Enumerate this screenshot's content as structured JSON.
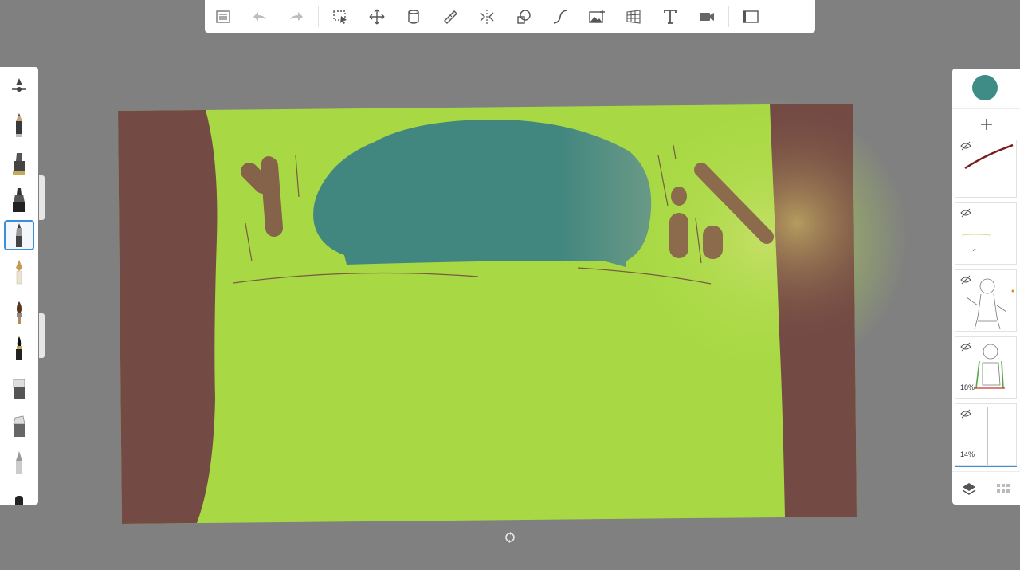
{
  "toolbar": {
    "icons": [
      "list-icon",
      "undo-icon",
      "redo-icon",
      "selection-icon",
      "transform-icon",
      "fill-icon",
      "ruler-icon",
      "symmetry-icon",
      "shapes-icon",
      "curve-icon",
      "image-icon",
      "perspective-icon",
      "text-icon",
      "record-icon",
      "fullscreen-icon"
    ]
  },
  "brushes": {
    "icons": [
      "brush-size-icon",
      "pencil-icon",
      "airbrush-icon",
      "marker-icon",
      "ballpoint-icon",
      "fountain-pen-icon",
      "paintbrush-icon",
      "ink-brush-icon",
      "eraser-icon",
      "hard-eraser-icon",
      "smudge-icon",
      "chisel-icon"
    ],
    "selected_index": 3
  },
  "colors": {
    "current": "#3f8c86",
    "background": "#808080",
    "canvas_green": "#a8d944",
    "tree_brown": "#744b44",
    "foliage_teal": "#428680",
    "selection_blue": "#3b8fd6"
  },
  "layers": {
    "items": [
      {
        "name": "layer-1",
        "opacity": ""
      },
      {
        "name": "layer-2",
        "opacity": ""
      },
      {
        "name": "layer-3",
        "opacity": ""
      },
      {
        "name": "layer-4",
        "opacity": "18%"
      },
      {
        "name": "layer-5",
        "opacity": "14%"
      }
    ]
  }
}
